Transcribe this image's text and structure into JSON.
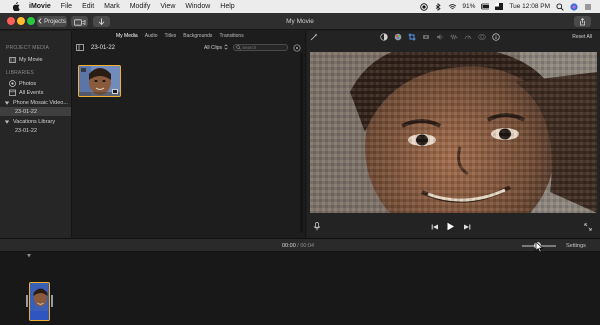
{
  "menubar": {
    "apple_icon": "apple-icon",
    "app_name": "iMovie",
    "items": [
      "File",
      "Edit",
      "Mark",
      "Modify",
      "View",
      "Window",
      "Help"
    ],
    "status": {
      "battery": "91%",
      "clock": "Tue 12:08 PM"
    }
  },
  "toolbar": {
    "projects_label": "Projects",
    "title": "My Movie"
  },
  "sidebar": {
    "project_media_heading": "PROJECT MEDIA",
    "project_item": "My Movie",
    "libraries_heading": "LIBRARIES",
    "photos_item": "Photos",
    "all_events_item": "All Events",
    "library_1": "Phone Mosaic Video...",
    "library_1_event": "23-01-22",
    "library_2": "Vacations Library",
    "library_2_event": "23-01-22"
  },
  "browser": {
    "tabs": [
      "My Media",
      "Audio",
      "Titles",
      "Backgrounds",
      "Transitions"
    ],
    "event_title": "23-01-22",
    "filter_label": "All Clips",
    "search_placeholder": "Search"
  },
  "viewer": {
    "reset_all": "Reset All"
  },
  "timebar": {
    "current_time": "00:00",
    "total_time": "/ 00:04",
    "settings_label": "Settings"
  },
  "colors": {
    "selection_accent": "#f2b130",
    "window_background": "#1e1e1e"
  }
}
